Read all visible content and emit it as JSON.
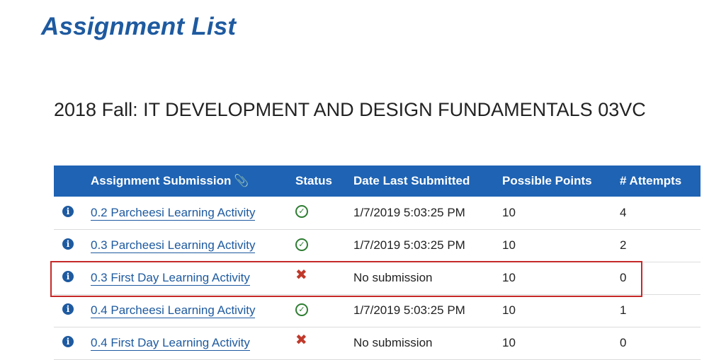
{
  "page_title": "Assignment List",
  "course_title": "2018 Fall: IT DEVELOPMENT AND DESIGN FUNDAMENTALS 03VC",
  "table": {
    "headers": {
      "assignment": "Assignment Submission",
      "status": "Status",
      "date": "Date Last Submitted",
      "points": "Possible Points",
      "attempts": "# Attempts"
    },
    "attachment_icon": "paperclip-icon",
    "rows": [
      {
        "name": "0.2 Parcheesi Learning Activity",
        "status": "check-circle-icon",
        "date": "1/7/2019 5:03:25 PM",
        "points": "10",
        "attempts": "4"
      },
      {
        "name": "0.3 Parcheesi Learning Activity",
        "status": "check-circle-icon",
        "date": "1/7/2019 5:03:25 PM",
        "points": "10",
        "attempts": "2"
      },
      {
        "name": "0.3 First Day Learning Activity",
        "status": "x-icon",
        "date": "No submission",
        "points": "10",
        "attempts": "0"
      },
      {
        "name": "0.4 Parcheesi Learning Activity",
        "status": "check-circle-icon",
        "date": "1/7/2019 5:03:25 PM",
        "points": "10",
        "attempts": "1"
      },
      {
        "name": "0.4 First Day Learning Activity",
        "status": "x-icon",
        "date": "No submission",
        "points": "10",
        "attempts": "0"
      }
    ]
  },
  "colors": {
    "brand": "#1e5aa0",
    "header_bg": "#1e63b4",
    "ok": "#2e7d32",
    "fail": "#c0392b",
    "highlight": "#c62828"
  }
}
